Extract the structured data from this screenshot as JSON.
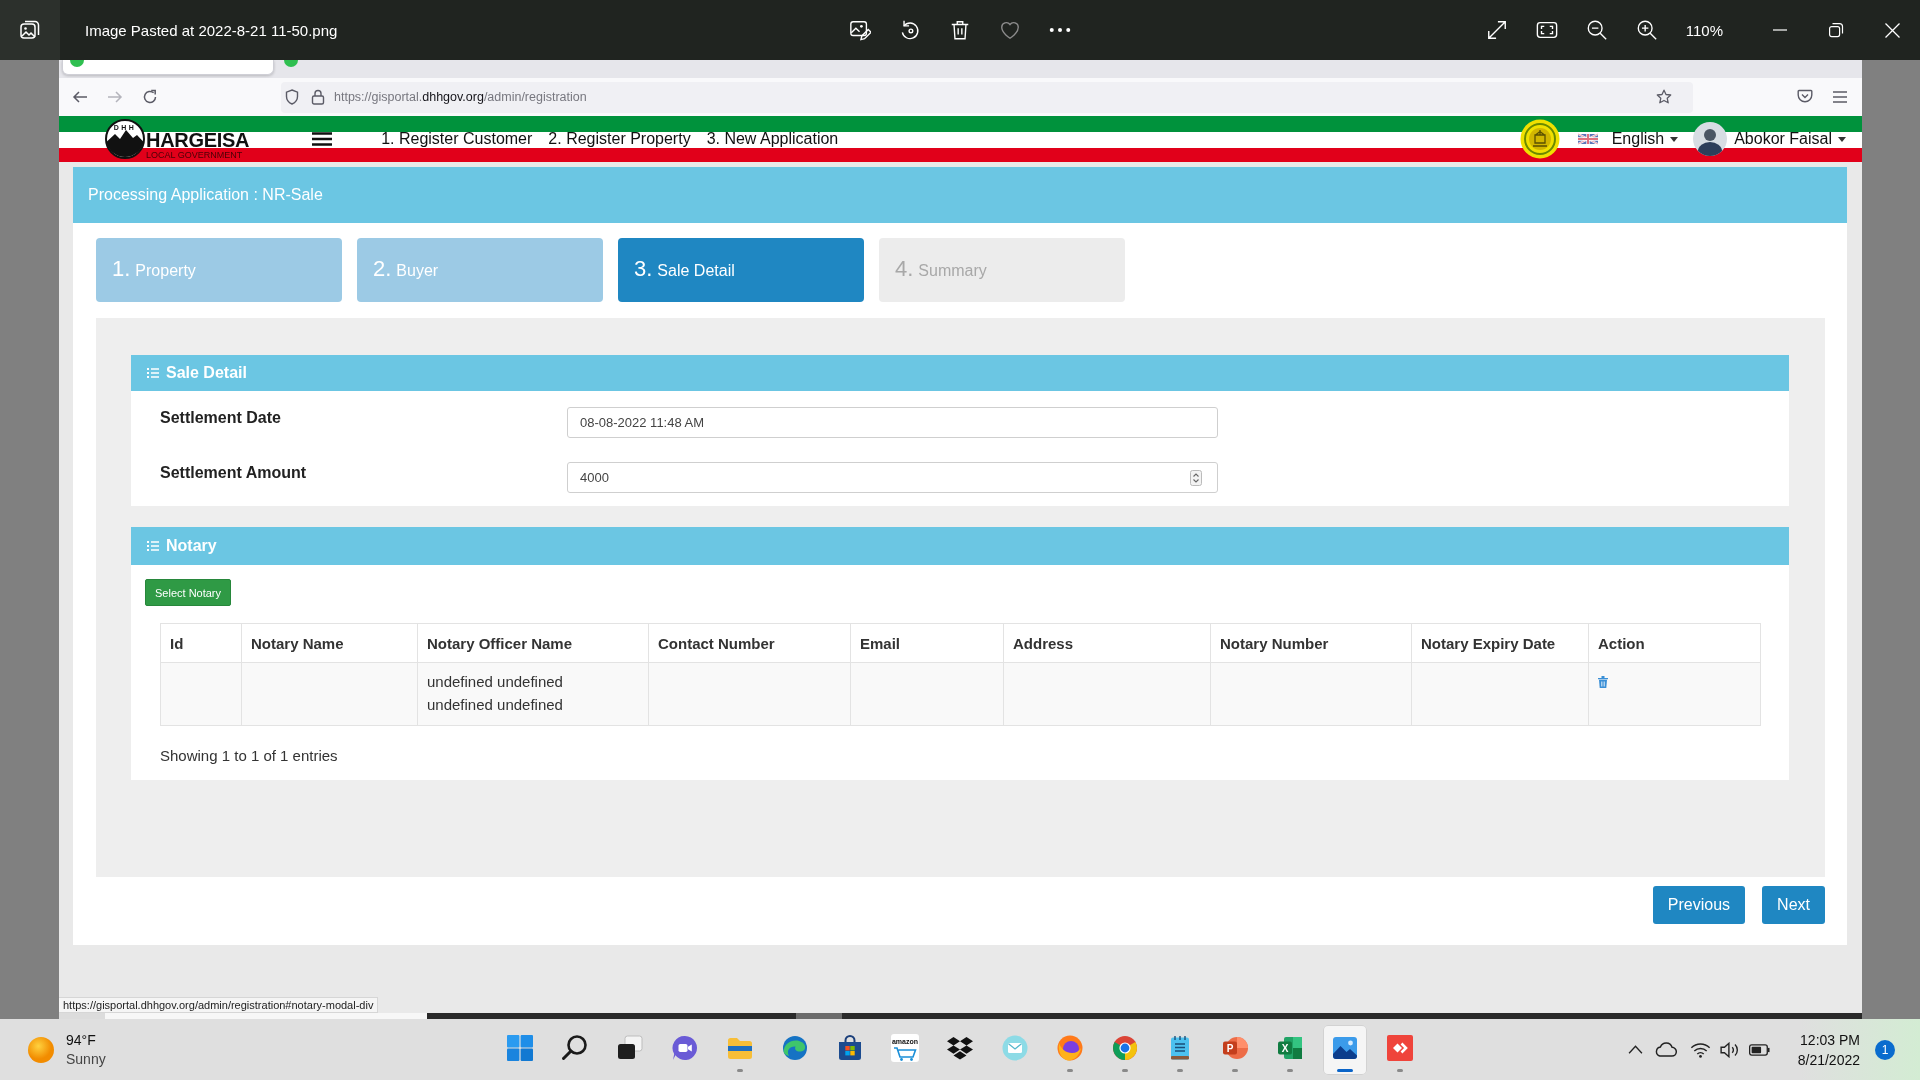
{
  "photo_viewer": {
    "title": "Image Pasted at 2022-8-21 11-50.png",
    "zoom": "110%"
  },
  "browser": {
    "tabs": [
      {
        "selected": true
      },
      {
        "selected": false
      }
    ],
    "address": {
      "prefix": "https://gisportal.",
      "domain": "dhhgov.org",
      "path": "/admin/registration"
    }
  },
  "site_header": {
    "logo_letters": "DHH",
    "logo_title": "HARGEISA",
    "logo_subtitle": "LOCAL GOVERNMENT",
    "nav": [
      "1. Register Customer",
      "2. Register Property",
      "3. New Application"
    ],
    "language": "English",
    "user": "Abokor Faisal"
  },
  "application": {
    "title": "Processing Application : NR-Sale",
    "steps": [
      {
        "number": "1.",
        "label": "Property",
        "completed": true,
        "selected": false
      },
      {
        "number": "2.",
        "label": "Buyer",
        "completed": true,
        "selected": false
      },
      {
        "number": "3.",
        "label": "Sale Detail",
        "completed": false,
        "selected": true
      },
      {
        "number": "4.",
        "label": "Summary",
        "completed": false,
        "selected": false
      }
    ],
    "sale_detail": {
      "title": "Sale Detail",
      "fields": [
        {
          "label": "Settlement Date",
          "value": "08-08-2022 11:48 AM",
          "kind": "text"
        },
        {
          "label": "Settlement Amount",
          "value": "4000",
          "kind": "number"
        }
      ]
    },
    "notary": {
      "title": "Notary",
      "select_button": "Select Notary",
      "table": {
        "columns": [
          {
            "label": "Id",
            "kind": "text"
          },
          {
            "label": "Notary Name",
            "kind": "text"
          },
          {
            "label": "Notary Officer Name",
            "kind": "text"
          },
          {
            "label": "Contact Number",
            "kind": "text"
          },
          {
            "label": "Email",
            "kind": "text"
          },
          {
            "label": "Address",
            "kind": "text"
          },
          {
            "label": "Notary Number",
            "kind": "text"
          },
          {
            "label": "Notary Expiry Date",
            "kind": "text"
          },
          {
            "label": "Action",
            "kind": "action"
          }
        ],
        "rows": [
          {
            "cells": [
              null,
              null,
              "undefined undefined undefined undefined",
              null,
              null,
              null,
              null,
              null,
              null
            ]
          }
        ]
      },
      "info": "Showing 1 to 1 of 1 entries"
    },
    "buttons": [
      "Previous",
      "Next"
    ]
  },
  "browser_status_bar": {
    "link": "https://gisportal.dhhgov.org/admin/registration#notary-modal-div"
  },
  "taskbar": {
    "weather": {
      "temperature": "94°F",
      "condition": "Sunny"
    },
    "apps": [
      {
        "kind": "start",
        "running": false,
        "selected": false
      },
      {
        "kind": "search",
        "running": false,
        "selected": false
      },
      {
        "kind": "taskview",
        "running": false,
        "selected": false
      },
      {
        "kind": "chat",
        "running": false,
        "selected": false
      },
      {
        "kind": "folder",
        "running": true,
        "selected": false
      },
      {
        "kind": "swirl",
        "running": false,
        "selected": false
      },
      {
        "kind": "bag",
        "running": false,
        "selected": false
      },
      {
        "kind": "cart",
        "label": "amazon",
        "running": false,
        "selected": false
      },
      {
        "kind": "boxes",
        "running": false,
        "selected": false
      },
      {
        "kind": "mail",
        "running": false,
        "selected": false
      },
      {
        "kind": "flamefox",
        "running": true,
        "selected": false
      },
      {
        "kind": "wheel",
        "running": true,
        "selected": false
      },
      {
        "kind": "notepad",
        "running": true,
        "selected": false
      },
      {
        "kind": "slides",
        "label": "P",
        "running": true,
        "selected": false
      },
      {
        "kind": "sheet",
        "label": "X",
        "running": true,
        "selected": false
      },
      {
        "kind": "photos",
        "running": true,
        "selected": true
      },
      {
        "kind": "remote",
        "running": true,
        "selected": false
      }
    ],
    "clock": {
      "time": "12:03 PM",
      "date": "8/21/2022"
    },
    "notification_count": "1"
  }
}
